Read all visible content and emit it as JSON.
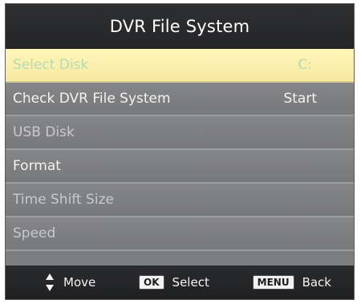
{
  "window": {
    "title": "DVR File System"
  },
  "menu": {
    "items": [
      {
        "label": "Select Disk",
        "value": "C:"
      },
      {
        "label": "Check DVR File System",
        "value": "Start"
      },
      {
        "label": "USB Disk",
        "value": ""
      },
      {
        "label": "Format",
        "value": ""
      },
      {
        "label": "Time Shift Size",
        "value": ""
      },
      {
        "label": "Speed",
        "value": ""
      }
    ],
    "selected_index": 0
  },
  "footer": {
    "move_label": "Move",
    "ok_key": "OK",
    "select_label": "Select",
    "menu_key": "MENU",
    "back_label": "Back"
  },
  "colors": {
    "title_bar": "#2e2f31",
    "row_background": "#7d7e80",
    "selected_row": "#fff6b8",
    "selected_text": "#b7dbb1",
    "footer_bar": "#2a2b2d"
  },
  "icons": {
    "move": "up-down-arrow-icon",
    "ok": "ok-key-icon",
    "menu": "menu-key-icon"
  }
}
